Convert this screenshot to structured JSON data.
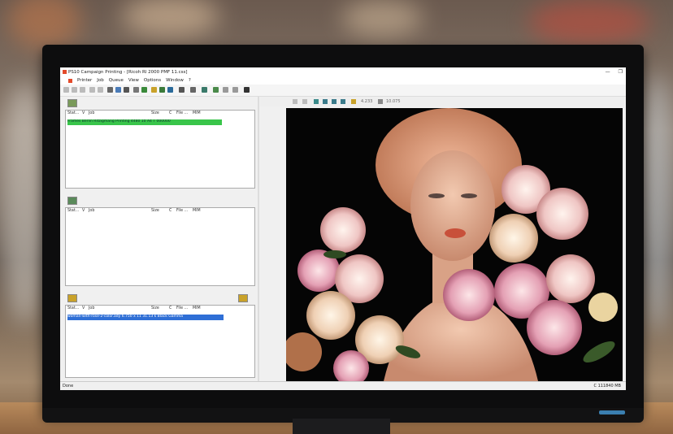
{
  "window": {
    "title": "PS10 Campaign Printing - [Ricoh RI 2000 PMF 11.css]",
    "controls": [
      "—",
      "❐",
      "✕"
    ]
  },
  "menu": [
    "Printer",
    "Job",
    "Queue",
    "View",
    "Options",
    "Window",
    "?"
  ],
  "print_queue": {
    "columns": [
      "Stat...",
      "V",
      "Job",
      "Size",
      "C",
      "File ...",
      "MIM"
    ],
    "rows": [
      {
        "text": "Frames Berlin Ritzigmang     Printing 4480 10 A4 T 000000",
        "color": "#39c54a"
      }
    ]
  },
  "hold_queue": {
    "columns": [
      "Stat...",
      "V",
      "Job",
      "Size",
      "C",
      "File ...",
      "MIM"
    ],
    "rows": []
  },
  "archive_queue": {
    "columns": [
      "Stat...",
      "V",
      "Job",
      "Size",
      "C",
      "File ...",
      "MIM"
    ],
    "rows": [
      {
        "text": "woman-with-rose-2-color.ady 6.750 x 11     31.13 k Black Gamma",
        "color": "#2f6fd6"
      }
    ]
  },
  "preview_toolbar": {
    "page": "4.233",
    "zoom": "10.075"
  },
  "status": {
    "left": "Done",
    "right": "C 111840 MB"
  },
  "colors": {
    "active_job": "#39c54a",
    "selected_job": "#2f6fd6",
    "canvas_bg": "#050505"
  }
}
